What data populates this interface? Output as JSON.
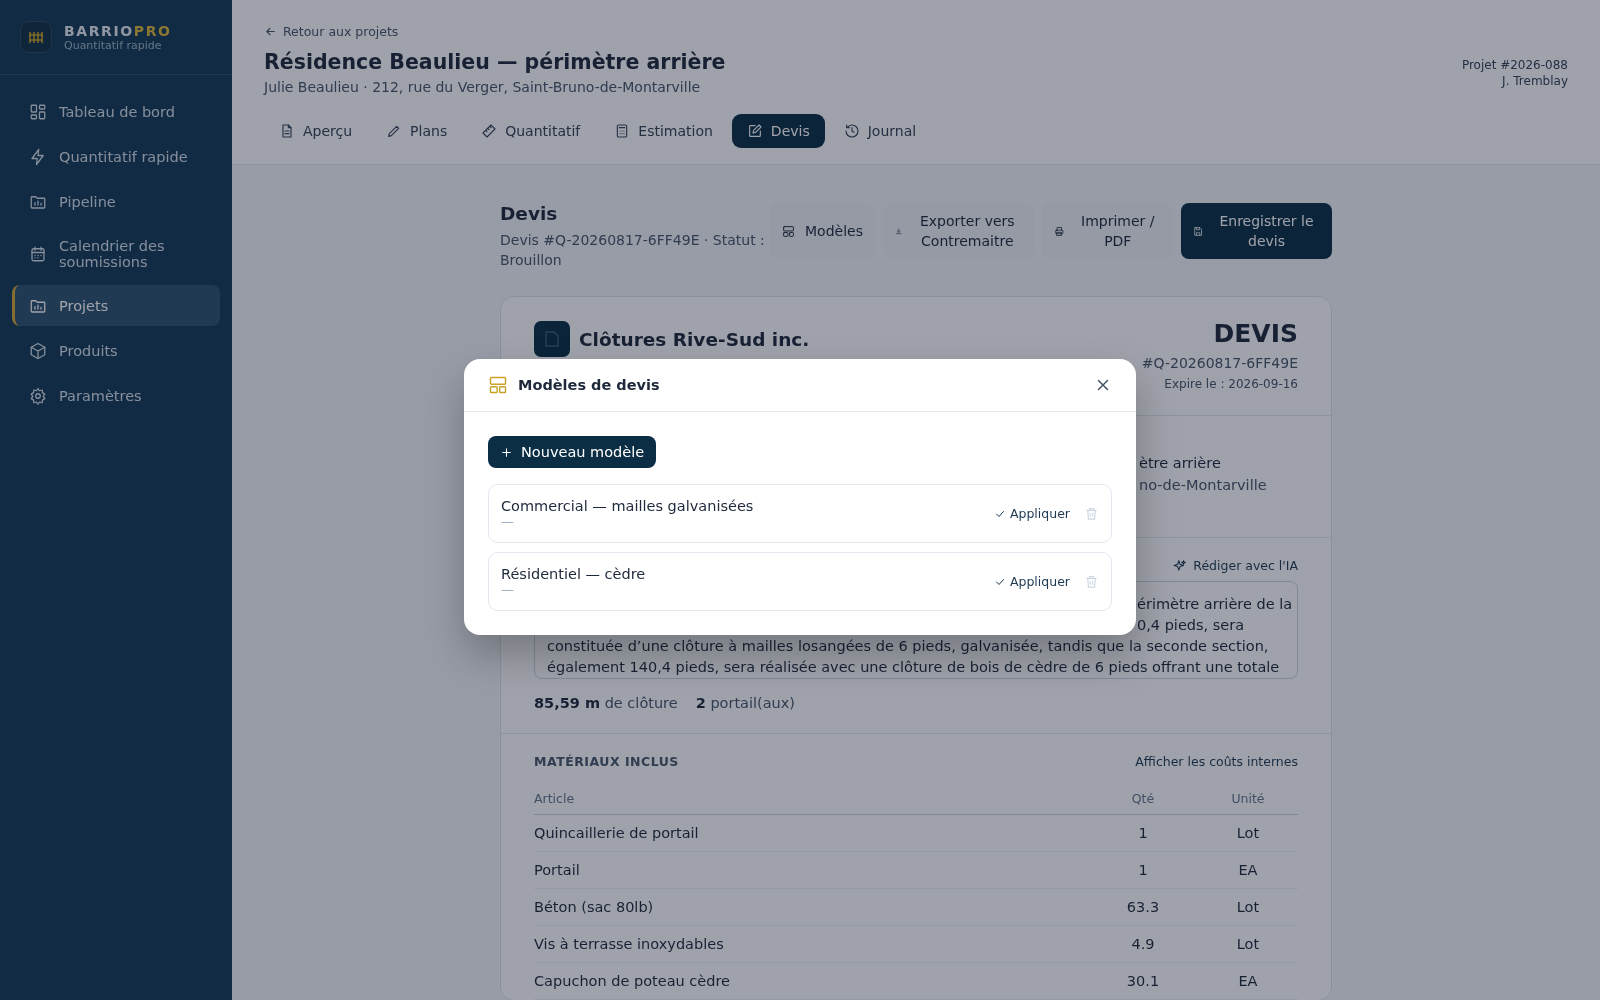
{
  "sidebar": {
    "brand_left": "BARRIO",
    "brand_right": "PRO",
    "tagline": "Quantitatif rapide",
    "items": [
      {
        "label": "Tableau de bord",
        "selected": false
      },
      {
        "label": "Quantitatif rapide",
        "selected": false
      },
      {
        "label": "Pipeline",
        "selected": false
      },
      {
        "label": "Calendrier des soumissions",
        "selected": false
      },
      {
        "label": "Projets",
        "selected": true
      },
      {
        "label": "Produits",
        "selected": false
      },
      {
        "label": "Paramètres",
        "selected": false
      }
    ]
  },
  "header": {
    "back_link": "Retour aux projets",
    "title": "Résidence Beaulieu — périmètre arrière",
    "subtitle": "Julie Beaulieu · 212, rue du Verger, Saint-Bruno-de-Montarville",
    "project_number": "Projet #2026-088",
    "owner": "J. Tremblay",
    "tabs": [
      {
        "label": "Aperçu",
        "selected": false
      },
      {
        "label": "Plans",
        "selected": false
      },
      {
        "label": "Quantitatif",
        "selected": false
      },
      {
        "label": "Estimation",
        "selected": false
      },
      {
        "label": "Devis",
        "selected": true
      },
      {
        "label": "Journal",
        "selected": false
      }
    ]
  },
  "quote": {
    "title": "Devis",
    "meta": "Devis #Q-20260817-6FF49E · Statut : Brouillon",
    "actions": [
      {
        "label": "Modèles",
        "primary": false
      },
      {
        "label": "Exporter vers Contremaitre",
        "primary": false
      },
      {
        "label": "Imprimer / PDF",
        "primary": false
      },
      {
        "label": "Enregistrer le devis",
        "primary": true
      }
    ]
  },
  "document": {
    "company": "Clôtures Rive-Sud inc.",
    "doc_title": "DEVIS",
    "number": "#Q-20260817-6FF49E",
    "expiry": "Expire le : 2026-09-16",
    "client_lines": [
      "ètre arrière",
      "no-de-Montarville"
    ],
    "ai_button": "Rédiger avec l'IA",
    "description_lines": [
      {
        "text": "érimètre arrière de la",
        "behind_dialog": true
      },
      {
        "text": "0,4 pieds, sera",
        "behind_dialog": true
      },
      {
        "text": "constituée d’une clôture à mailles losangées de 6 pieds, galvanisée, tandis que la seconde section,",
        "behind_dialog": false
      },
      {
        "text": "également 140,4 pieds, sera réalisée avec une clôture de bois de cèdre de 6 pieds offrant une totale",
        "behind_dialog": false
      }
    ],
    "stats": [
      "**85,59 m** de clôture",
      "**2** portail(aux)"
    ],
    "materials": {
      "title": "MATÉRIAUX INCLUS",
      "toggle": "Afficher les coûts internes",
      "columns": [
        "Article",
        "Qté",
        "Unité"
      ],
      "rows": [
        [
          "Quincaillerie de portail",
          "1",
          "Lot"
        ],
        [
          "Portail",
          "1",
          "EA"
        ],
        [
          "Béton (sac 80lb)",
          "63.3",
          "Lot"
        ],
        [
          "Vis à terrasse inoxydables",
          "4.9",
          "Lot"
        ],
        [
          "Capuchon de poteau cèdre",
          "30.1",
          "EA"
        ]
      ]
    }
  },
  "modal": {
    "title": "Modèles de devis",
    "new_button": "Nouveau modèle",
    "templates": [
      {
        "name": "Commercial — mailles galvanisées",
        "description": "—",
        "apply": "Appliquer"
      },
      {
        "name": "Résidentiel — cèdre",
        "description": "—",
        "apply": "Appliquer"
      }
    ]
  }
}
